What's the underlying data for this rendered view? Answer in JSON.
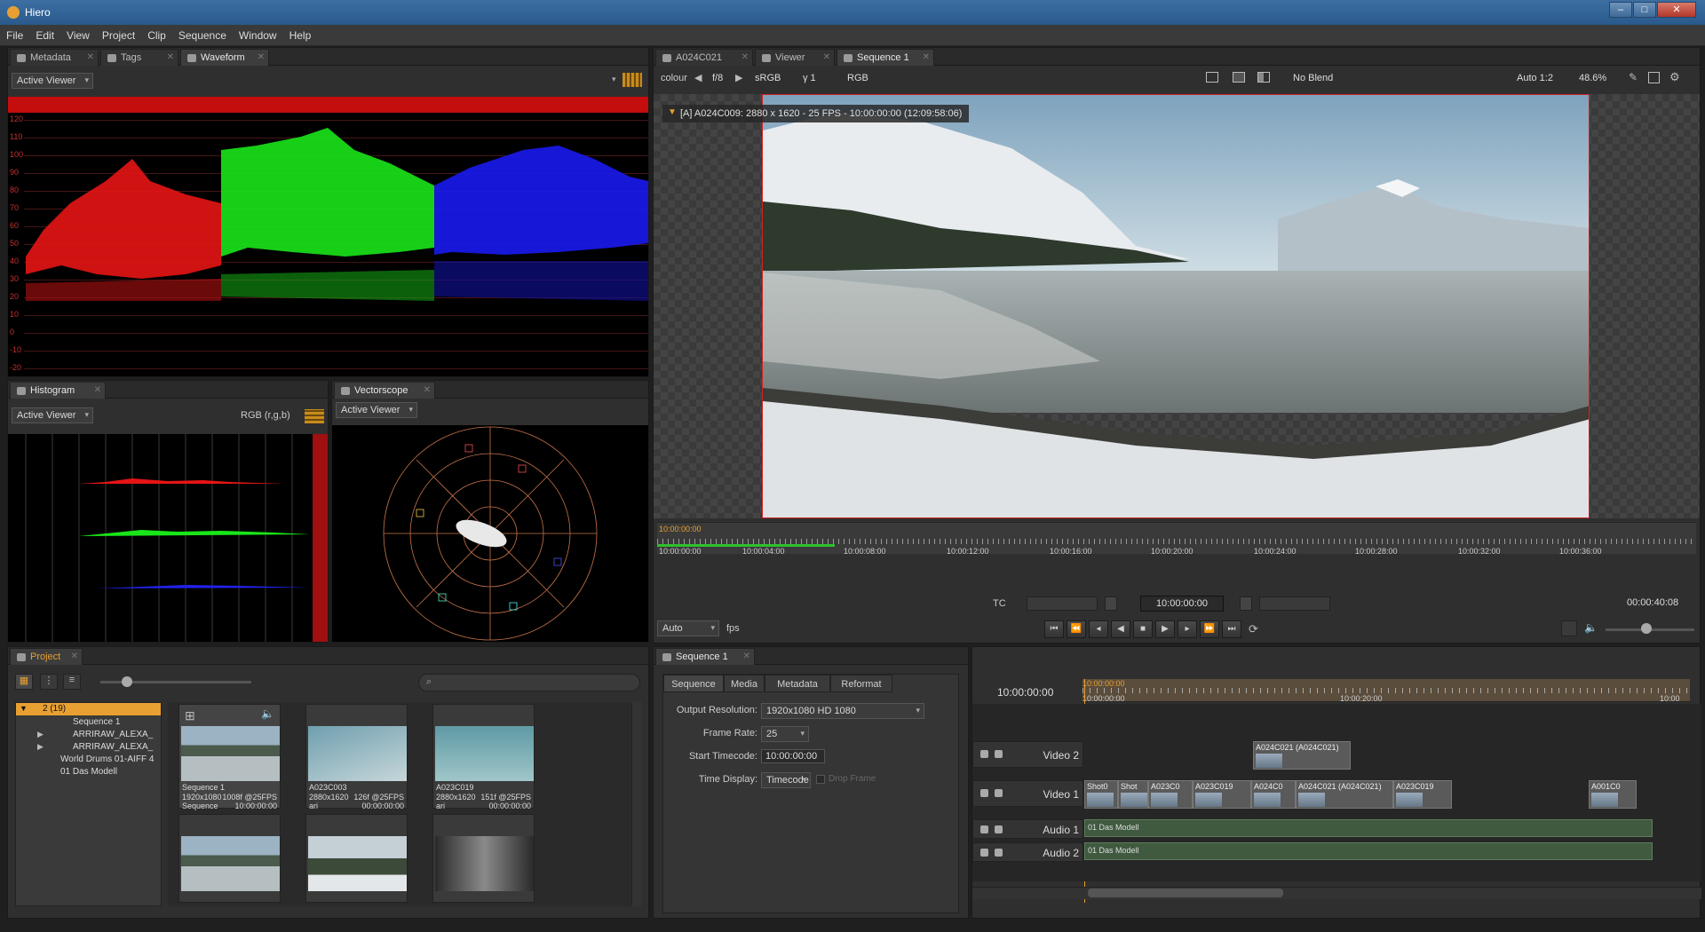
{
  "window": {
    "title": "Hiero",
    "controls": [
      "–",
      "□",
      "✕"
    ]
  },
  "menu": [
    "File",
    "Edit",
    "View",
    "Project",
    "Clip",
    "Sequence",
    "Window",
    "Help"
  ],
  "left_top_tabs": [
    {
      "label": "Metadata",
      "active": false
    },
    {
      "label": "Tags",
      "active": false
    },
    {
      "label": "Waveform",
      "active": true
    }
  ],
  "waveform": {
    "viewer_select": "Active Viewer",
    "scale": [
      "120",
      "110",
      "100",
      "90",
      "80",
      "70",
      "60",
      "50",
      "40",
      "30",
      "20",
      "10",
      "0",
      "-10",
      "-20"
    ]
  },
  "histogram": {
    "tab": "Histogram",
    "viewer_select": "Active Viewer",
    "channel_select": "RGB (r,g,b)"
  },
  "vectorscope": {
    "tab": "Vectorscope",
    "viewer_select": "Active Viewer"
  },
  "viewer": {
    "tabs": [
      {
        "label": "A024C021",
        "active": false
      },
      {
        "label": "Viewer",
        "active": false
      },
      {
        "label": "Sequence 1",
        "active": true
      }
    ],
    "toolbar": {
      "colour": "colour",
      "fstop": "f/8",
      "lut": "sRGB",
      "gamma": "γ 1",
      "channels": "RGB",
      "blend": "No Blend",
      "proxy": "Auto 1:2",
      "zoom": "48.6%"
    },
    "overlay": "[A] A024C009: 2880 x 1620 - 25 FPS - 10:00:00:00 (12:09:58:06)",
    "timeline_ticks": [
      "10:00:00:00",
      "10:00:04:00",
      "10:00:08:00",
      "10:00:12:00",
      "10:00:16:00",
      "10:00:20:00",
      "10:00:24:00",
      "10:00:28:00",
      "10:00:32:00",
      "10:00:36:00"
    ],
    "playhead_tc": "10:00:00:00",
    "tc_mode": "TC",
    "current_tc": "10:00:00:00",
    "duration": "00:00:40:08",
    "fps_select": "Auto",
    "fps_label": "fps"
  },
  "project": {
    "tab": "Project",
    "bin_root": "2 (19)",
    "tree": [
      "Sequence 1",
      "ARRIRAW_ALEXA_",
      "ARRIRAW_ALEXA_",
      "World Drums 01-AIFF 4",
      "01 Das Modell"
    ],
    "items": [
      {
        "name": "Sequence 1",
        "res": "1920x1080",
        "frames": "1008f @25FPS",
        "type": "Sequence",
        "tc": "10:00:00:00"
      },
      {
        "name": "A023C003",
        "res": "2880x1620",
        "frames": "126f @25FPS",
        "type": "ari",
        "tc": "00:00:00:00"
      },
      {
        "name": "A023C019",
        "res": "2880x1620",
        "frames": "151f @25FPS",
        "type": "ari",
        "tc": "00:00:00:00"
      }
    ]
  },
  "sequence_panel": {
    "tab": "Sequence 1",
    "subtabs": [
      "Sequence",
      "Media",
      "Metadata",
      "Reformat"
    ],
    "output_resolution_label": "Output Resolution:",
    "output_resolution": "1920x1080 HD 1080",
    "frame_rate_label": "Frame Rate:",
    "frame_rate": "25",
    "start_tc_label": "Start Timecode:",
    "start_tc": "10:00:00:00",
    "time_display_label": "Time Display:",
    "time_display": "Timecode",
    "drop_frame": "Drop Frame"
  },
  "timeline": {
    "current_tc": "10:00:00:00",
    "ruler": [
      "10:00:00:00",
      "10:00:20:00",
      "10:00"
    ],
    "playhead": "10:00:00:00",
    "tracks": [
      "Video 2",
      "Video 1",
      "Audio 1",
      "Audio 2"
    ],
    "video2_clips": [
      "A024C021 (A024C021)"
    ],
    "video1_clips": [
      "Shot0",
      "Shot",
      "A023C0",
      "A023C019",
      "A024C0",
      "A024C021 (A024C021)",
      "A023C019",
      "A001C0"
    ],
    "audio_clips": [
      "01 Das Modell",
      "01 Das Modell"
    ]
  }
}
